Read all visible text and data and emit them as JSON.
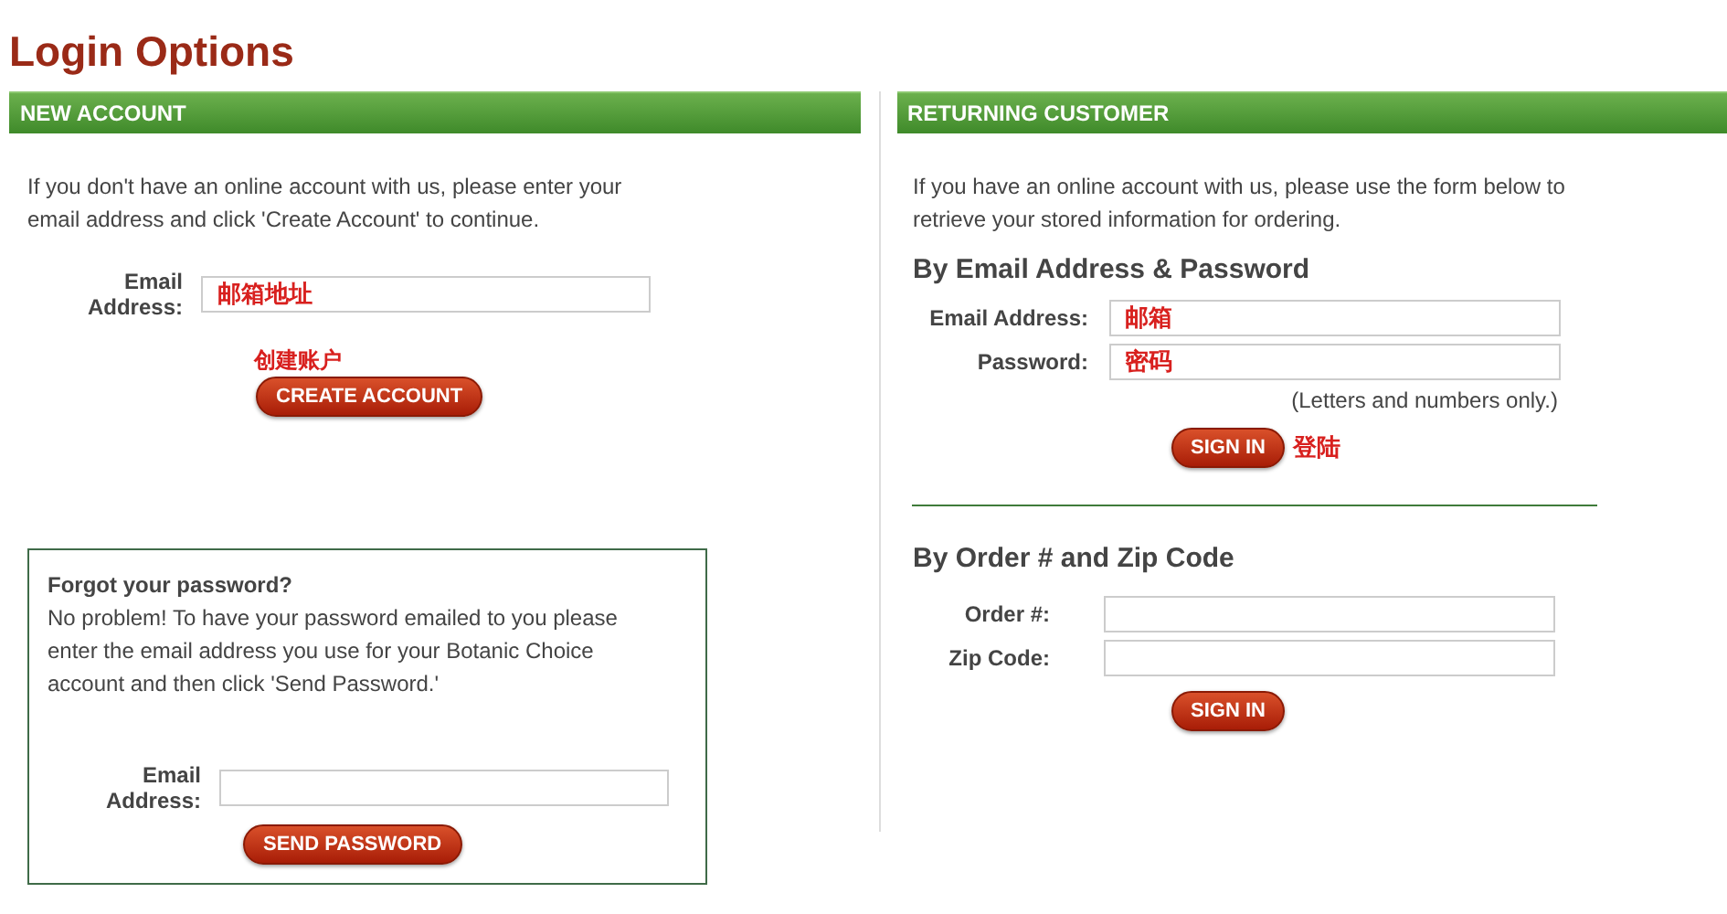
{
  "title": "Login Options",
  "new_account": {
    "header": "NEW ACCOUNT",
    "intro": "If you don't have an online account with us, please enter your email address and click 'Create Account' to continue.",
    "fields": [
      {
        "label": "Email Address:",
        "annotation": "邮箱地址"
      }
    ],
    "button_annotation": "创建账户",
    "button": "CREATE ACCOUNT"
  },
  "forgot": {
    "title": "Forgot your password?",
    "text": "No problem! To have your password emailed to you please enter the email address you use for your Botanic Choice account and then click 'Send Password.'",
    "fields": [
      {
        "label": "Email Address:"
      }
    ],
    "button": "SEND PASSWORD"
  },
  "returning": {
    "header": "RETURNING CUSTOMER",
    "intro": "If you have an online account with us, please use the form below to retrieve your stored information for ordering.",
    "sections": [
      {
        "title": "By Email Address & Password",
        "fields": [
          {
            "label": "Email Address:",
            "annotation": "邮箱"
          },
          {
            "label": "Password:",
            "annotation": "密码"
          }
        ],
        "note": "(Letters and numbers only.)",
        "button": "SIGN IN",
        "button_annotation": "登陆"
      },
      {
        "title": "By Order # and Zip Code",
        "fields": [
          {
            "label": "Order #:"
          },
          {
            "label": "Zip Code:"
          }
        ],
        "button": "SIGN IN"
      }
    ]
  }
}
